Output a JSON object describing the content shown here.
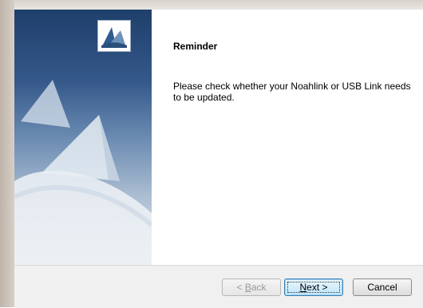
{
  "dialog": {
    "heading": "Reminder",
    "message": "Please check whether your Noahlink or USB Link needs to be updated."
  },
  "buttons": {
    "back_mnemonic": "B",
    "back_prefix": "< ",
    "back_suffix": "ack",
    "next_mnemonic": "N",
    "next_suffix": "ext >",
    "cancel_label": "Cancel"
  },
  "icons": {
    "setup_logo": "installer-logo-icon"
  },
  "colors": {
    "side_panel_dark": "#1f3f6b",
    "side_panel_light": "#dfe6ee",
    "footer_bg": "#f0f0f0",
    "next_button_border": "#3c7fb1"
  }
}
